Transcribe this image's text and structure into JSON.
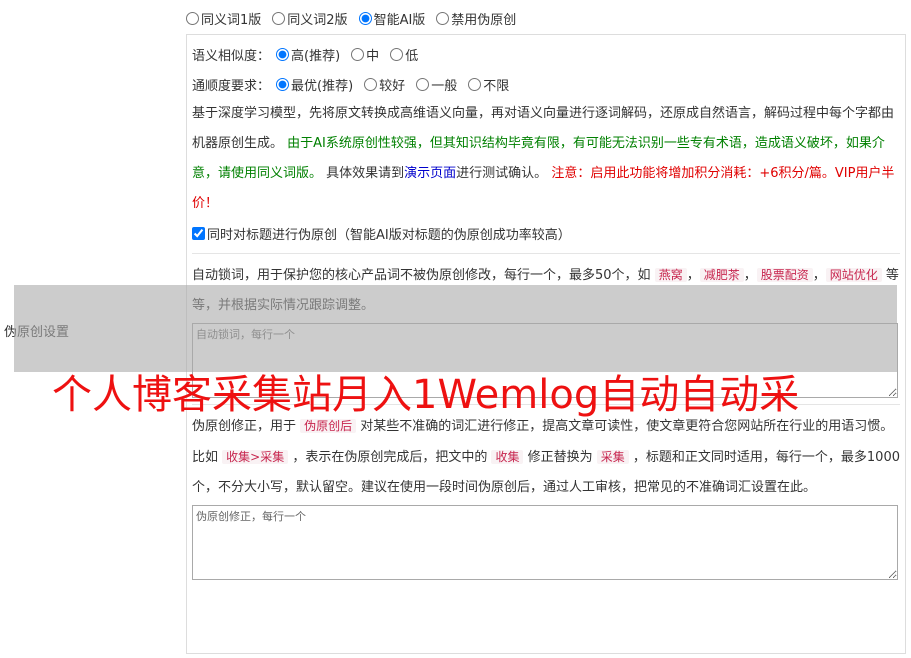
{
  "mode_options": [
    {
      "label": "同义词1版",
      "checked": false
    },
    {
      "label": "同义词2版",
      "checked": false
    },
    {
      "label": "智能AI版",
      "checked": true
    },
    {
      "label": "禁用伪原创",
      "checked": false
    }
  ],
  "side_label": "伪原创设置",
  "similarity": {
    "label": "语义相似度：",
    "options": [
      {
        "label": "高(推荐)",
        "checked": true
      },
      {
        "label": "中",
        "checked": false
      },
      {
        "label": "低",
        "checked": false
      }
    ]
  },
  "fluency": {
    "label": "通顺度要求：",
    "options": [
      {
        "label": "最优(推荐)",
        "checked": true
      },
      {
        "label": "较好",
        "checked": false
      },
      {
        "label": "一般",
        "checked": false
      },
      {
        "label": "不限",
        "checked": false
      }
    ]
  },
  "description": {
    "part1": "基于深度学习模型，先将原文转换成高维语义向量，再对语义向量进行逐词解码，还原成自然语言，解码过程中每个字都由机器原创生成。 ",
    "part2_green": "由于AI系统原创性较强，但其知识结构毕竟有限，有可能无法识别一些专有术语，造成语义破坏，如果介意，请使用同义词版。",
    "part3": " 具体效果请到",
    "demo_link": "演示页面",
    "part4": "进行测试确认。 ",
    "part5_red": "注意：启用此功能将增加积分消耗：+6积分/篇。VIP用户半价！"
  },
  "title_checkbox": {
    "label": "同时对标题进行伪原创（智能AI版对标题的伪原创成功率较高）",
    "checked": true
  },
  "lock_words": {
    "text1": "自动锁词，用于保护您的核心产品词不被伪原创修改，每行一个，最多50个，如 ",
    "tag1": "燕窝",
    "sep": "，",
    "tag2": "减肥茶",
    "tag3": "股票配资",
    "tag4": "网站优化",
    "text2": " 等等，并根据实际情况跟踪调整。",
    "placeholder": "自动锁词，每行一个"
  },
  "correction": {
    "text1": "伪原创修正，用于 ",
    "tag1": "伪原创后",
    "text2": " 对某些不准确的词汇进行修正，提高文章可读性，使文章更符合您网站所在行业的用语习惯。比如 ",
    "tag2": "收集>采集",
    "text3": " ，表示在伪原创完成后，把文中的 ",
    "tag3": "收集",
    "text4": " 修正替换为 ",
    "tag4": "采集",
    "text5": " ，标题和正文同时适用，每行一个，最多1000个，不分大小写，默认留空。建议在使用一段时间伪原创后，通过人工审核，把常见的不准确词汇设置在此。",
    "placeholder": "伪原创修正，每行一个"
  },
  "watermark": "个人博客采集站月入1Wemlog自动自动采",
  "colors": {
    "green": "#008000",
    "red": "#e00000",
    "link": "#0000cc",
    "tag": "#c7254e"
  }
}
